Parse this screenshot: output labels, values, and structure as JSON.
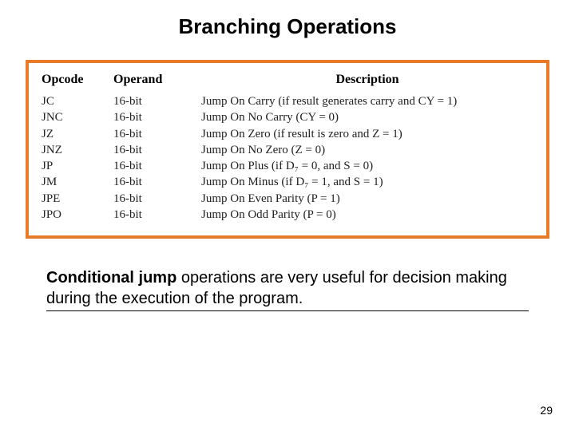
{
  "title": "Branching Operations",
  "headers": {
    "opcode": "Opcode",
    "operand": "Operand",
    "description": "Description"
  },
  "rows": [
    {
      "opcode": "JC",
      "operand": "16-bit",
      "description": "Jump On Carry (if result generates carry and CY = 1)"
    },
    {
      "opcode": "JNC",
      "operand": "16-bit",
      "description": "Jump On No Carry (CY = 0)"
    },
    {
      "opcode": "JZ",
      "operand": "16-bit",
      "description": "Jump On Zero (if result is zero and Z = 1)"
    },
    {
      "opcode": "JNZ",
      "operand": "16-bit",
      "description": "Jump On No Zero (Z = 0)"
    },
    {
      "opcode": "JP",
      "operand": "16-bit",
      "description": "Jump On Plus (if D₇ = 0, and S = 0)"
    },
    {
      "opcode": "JM",
      "operand": "16-bit",
      "description": "Jump On Minus (if D₇ = 1, and S = 1)"
    },
    {
      "opcode": "JPE",
      "operand": "16-bit",
      "description": "Jump On Even Parity (P = 1)"
    },
    {
      "opcode": "JPO",
      "operand": "16-bit",
      "description": "Jump On Odd Parity (P = 0)"
    }
  ],
  "caption": {
    "bold": "Conditional jump",
    "rest": " operations are very useful for decision making during the execution of the program."
  },
  "page_number": "29"
}
